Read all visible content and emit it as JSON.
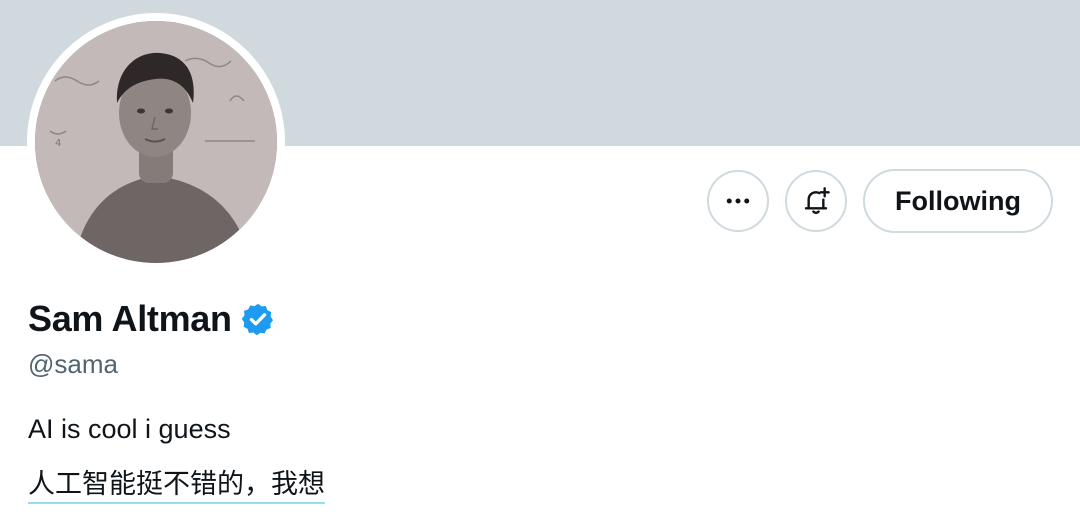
{
  "profile": {
    "display_name": "Sam Altman",
    "handle": "@sama",
    "verified": true,
    "bio": {
      "line1": "AI is cool i guess",
      "translation": "人工智能挺不错的，我想"
    }
  },
  "actions": {
    "more_icon": "more-horizontal-icon",
    "notify_icon": "bell-plus-icon",
    "follow_label": "Following"
  },
  "colors": {
    "banner": "#cfd9de",
    "verified_badge": "#1d9bf0",
    "text_primary": "#0f1419",
    "text_secondary": "#536471",
    "button_border": "#cfd9de",
    "translation_underline": "#8fe0ec"
  }
}
